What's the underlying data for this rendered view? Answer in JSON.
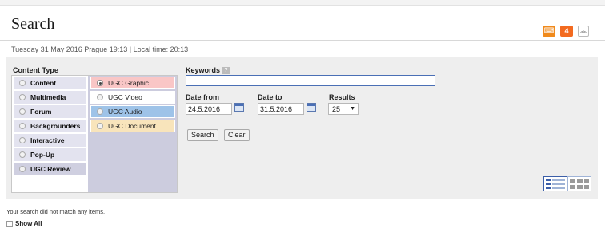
{
  "page": {
    "title": "Search",
    "datetime": "Tuesday 31 May 2016 Prague 19:13 | Local time: 20:13"
  },
  "toolbar": {
    "notifications_count": "4"
  },
  "content_type": {
    "label": "Content Type",
    "types": [
      {
        "label": "Content",
        "selected": false
      },
      {
        "label": "Multimedia",
        "selected": false
      },
      {
        "label": "Forum",
        "selected": false
      },
      {
        "label": "Backgrounders",
        "selected": false
      },
      {
        "label": "Interactive",
        "selected": false
      },
      {
        "label": "Pop-Up",
        "selected": false
      },
      {
        "label": "UGC Review",
        "selected": true
      }
    ],
    "subtypes": [
      {
        "label": "UGC Graphic",
        "selected": true,
        "color": "#f9c6c6"
      },
      {
        "label": "UGC Video",
        "selected": false,
        "color": "#ffffff"
      },
      {
        "label": "UGC Audio",
        "selected": false,
        "color": "#9ec3e8"
      },
      {
        "label": "UGC Document",
        "selected": false,
        "color": "#f8e4bb"
      }
    ]
  },
  "filters": {
    "keywords_label": "Keywords",
    "keywords_value": "",
    "date_from_label": "Date from",
    "date_from_value": "24.5.2016",
    "date_to_label": "Date to",
    "date_to_value": "31.5.2016",
    "results_label": "Results",
    "results_value": "25",
    "search_button": "Search",
    "clear_button": "Clear"
  },
  "results": {
    "message": "Your search did not match any items.",
    "show_all_label": "Show All",
    "show_all_checked": false
  },
  "colors": {
    "accent_orange": "#f36a1f",
    "panel_bg": "#eeeeee",
    "subtype_bg": "#ccccde"
  }
}
